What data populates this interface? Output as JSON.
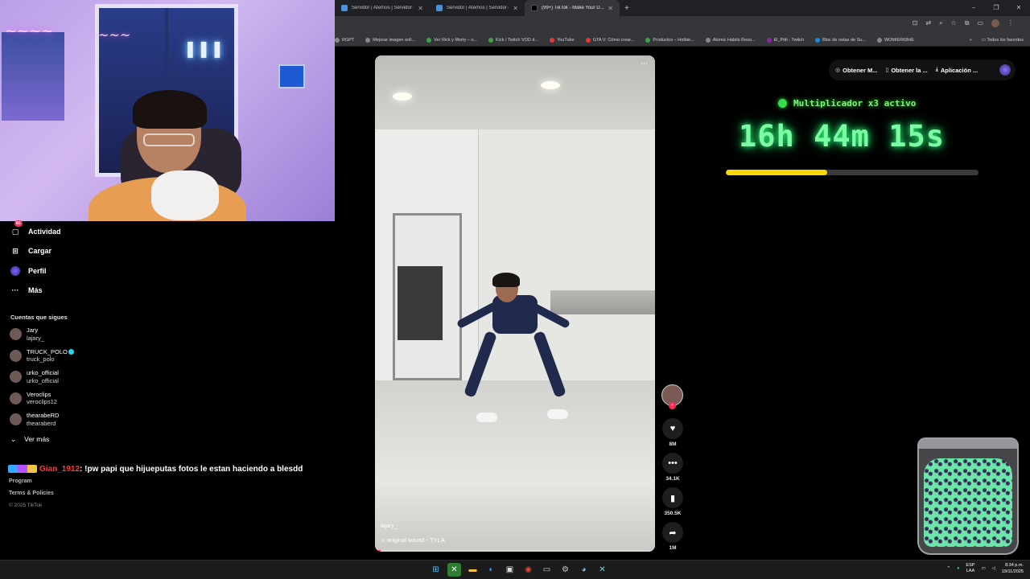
{
  "browser": {
    "tabs": [
      {
        "label": "Servidor | Aternos | Servidor de",
        "active": false,
        "favicon": "aternos"
      },
      {
        "label": "(99+) TikTok - Make Your D...",
        "active": true,
        "favicon": "tiktok"
      }
    ],
    "window_controls": {
      "minimize": "–",
      "maximize": "❐",
      "close": "✕"
    },
    "bookmarks": [
      {
        "label": "RGPT",
        "icon": "dot"
      },
      {
        "label": "Mejorar imagen onli...",
        "icon": "dot"
      },
      {
        "label": "Ver Rick y Morty – o...",
        "icon": "green"
      },
      {
        "label": "Kick / Twitch VOD d...",
        "icon": "green"
      },
      {
        "label": "YouTube",
        "icon": "red"
      },
      {
        "label": "GTA V: Cómo crear...",
        "icon": "red"
      },
      {
        "label": "Productos – Hotbie...",
        "icon": "green"
      },
      {
        "label": "Atomic Habits Reso...",
        "icon": "dot"
      },
      {
        "label": "El_Pitti - Twitch",
        "icon": "purple"
      },
      {
        "label": "Bloc de notas de Su...",
        "icon": "blue"
      },
      {
        "label": "WOMIER68HE",
        "icon": "dot"
      }
    ],
    "bookmarks_more": "»",
    "all_bookmarks": "Todos los favoritos"
  },
  "nav": {
    "activity": {
      "label": "Actividad",
      "badge": "85"
    },
    "upload": {
      "label": "Cargar"
    },
    "profile": {
      "label": "Perfil"
    },
    "more": {
      "label": "Más"
    },
    "following_title": "Cuentas que sigues",
    "following": [
      {
        "name": "Jary",
        "handle": "lajary_",
        "verified": false
      },
      {
        "name": "TRUCK_POLO",
        "handle": "truck_polo",
        "verified": true
      },
      {
        "name": "urko_official",
        "handle": "urko_official",
        "verified": false
      },
      {
        "name": "Veroclips",
        "handle": "veroclips12",
        "verified": false
      },
      {
        "name": "thearabeRD",
        "handle": "thearaberd",
        "verified": false
      }
    ],
    "see_more": "Ver más",
    "footer": {
      "program": "Program",
      "terms": "Terms & Policies",
      "copyright": "© 2025 TikTok"
    }
  },
  "chat": {
    "user": "Gian_1912",
    "message": ": !pw papi que hijueputas fotos le estan haciendo a blesdd"
  },
  "video": {
    "author": "lajary_",
    "sound": "original sound - TYLA",
    "more": "···",
    "progress": 0.02
  },
  "actions": {
    "likes": "8M",
    "comments": "34.1K",
    "saves": "350.5K",
    "shares": "1M"
  },
  "top_actions": [
    {
      "label": "Obtener M...",
      "icon": "coin-icon"
    },
    {
      "label": "Obtener la ...",
      "icon": "phone-icon"
    },
    {
      "label": "Aplicación ...",
      "icon": "download-icon"
    }
  ],
  "overlay": {
    "multiplier": "Multiplicador x3 activo",
    "timer": "16h 44m 15s",
    "progress": 0.4,
    "colors": {
      "timer": "#7ef9a4",
      "bar": "#f5d90a"
    }
  },
  "taskbar": {
    "lang_top": "ESP",
    "lang_bottom": "LAA",
    "time": "8:34 p.m.",
    "date": "19/11/2025"
  }
}
